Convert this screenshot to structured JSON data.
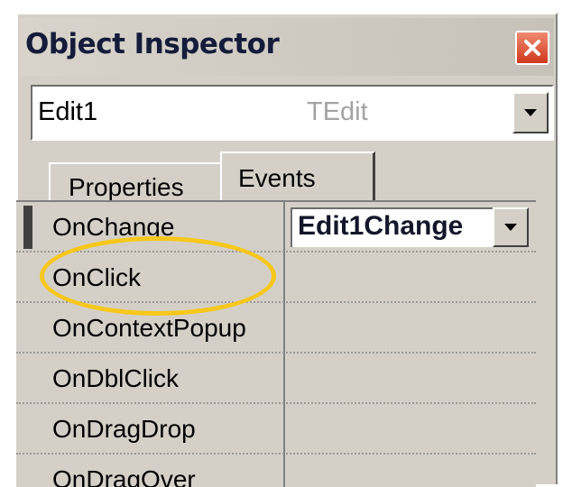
{
  "window": {
    "title": "Object Inspector",
    "close_icon": "close-icon"
  },
  "object_selector": {
    "name": "Edit1",
    "type": "TEdit",
    "dropdown_icon": "chevron-down-icon"
  },
  "tabs": [
    {
      "label": "Properties",
      "active": false
    },
    {
      "label": "Events",
      "active": true
    }
  ],
  "events": [
    {
      "name": "OnChange",
      "value": "Edit1Change",
      "selected": true
    },
    {
      "name": "OnClick",
      "value": ""
    },
    {
      "name": "OnContextPopup",
      "value": ""
    },
    {
      "name": "OnDblClick",
      "value": ""
    },
    {
      "name": "OnDragDrop",
      "value": ""
    },
    {
      "name": "OnDragOver",
      "value": ""
    }
  ],
  "colors": {
    "title_text": "#151b3a",
    "close_button": "#e05a3a",
    "highlight_ring": "#f7c71b",
    "window_face": "#d4d0c8"
  }
}
